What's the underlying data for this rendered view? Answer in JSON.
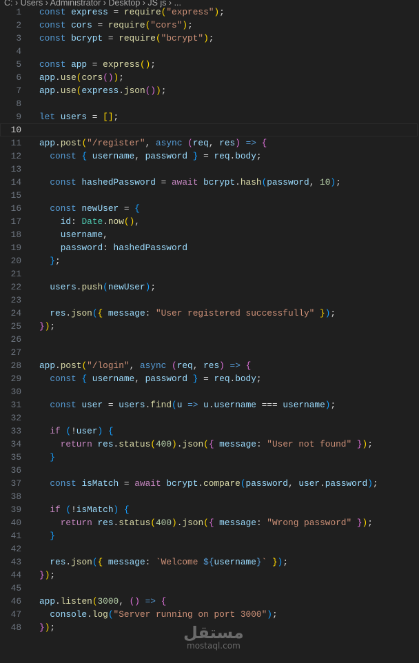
{
  "breadcrumb": "C: › Users › Administrator › Desktop › JS js › ...",
  "current_line": 10,
  "watermark": {
    "arabic": "مستقل",
    "latin": "mostaql.com"
  },
  "lines": [
    [
      [
        "k",
        "const "
      ],
      [
        "v",
        "express"
      ],
      [
        "p",
        " = "
      ],
      [
        "f",
        "require"
      ],
      [
        "b1",
        "("
      ],
      [
        "s",
        "\"express\""
      ],
      [
        "b1",
        ")"
      ],
      [
        "p",
        ";"
      ]
    ],
    [
      [
        "k",
        "const "
      ],
      [
        "v",
        "cors"
      ],
      [
        "p",
        " = "
      ],
      [
        "f",
        "require"
      ],
      [
        "b1",
        "("
      ],
      [
        "s",
        "\"cors\""
      ],
      [
        "b1",
        ")"
      ],
      [
        "p",
        ";"
      ]
    ],
    [
      [
        "k",
        "const "
      ],
      [
        "v",
        "bcrypt"
      ],
      [
        "p",
        " = "
      ],
      [
        "f",
        "require"
      ],
      [
        "b1",
        "("
      ],
      [
        "s",
        "\"bcrypt\""
      ],
      [
        "b1",
        ")"
      ],
      [
        "p",
        ";"
      ]
    ],
    [],
    [
      [
        "k",
        "const "
      ],
      [
        "v",
        "app"
      ],
      [
        "p",
        " = "
      ],
      [
        "f",
        "express"
      ],
      [
        "b1",
        "()"
      ],
      [
        "p",
        ";"
      ]
    ],
    [
      [
        "v",
        "app"
      ],
      [
        "p",
        "."
      ],
      [
        "f",
        "use"
      ],
      [
        "b1",
        "("
      ],
      [
        "f",
        "cors"
      ],
      [
        "b2",
        "()"
      ],
      [
        "b1",
        ")"
      ],
      [
        "p",
        ";"
      ]
    ],
    [
      [
        "v",
        "app"
      ],
      [
        "p",
        "."
      ],
      [
        "f",
        "use"
      ],
      [
        "b1",
        "("
      ],
      [
        "v",
        "express"
      ],
      [
        "p",
        "."
      ],
      [
        "f",
        "json"
      ],
      [
        "b2",
        "()"
      ],
      [
        "b1",
        ")"
      ],
      [
        "p",
        ";"
      ]
    ],
    [],
    [
      [
        "k",
        "let "
      ],
      [
        "v",
        "users"
      ],
      [
        "p",
        " = "
      ],
      [
        "b1",
        "[]"
      ],
      [
        "p",
        ";"
      ]
    ],
    [],
    [
      [
        "v",
        "app"
      ],
      [
        "p",
        "."
      ],
      [
        "f",
        "post"
      ],
      [
        "b1",
        "("
      ],
      [
        "s",
        "\"/register\""
      ],
      [
        "p",
        ", "
      ],
      [
        "k",
        "async "
      ],
      [
        "b2",
        "("
      ],
      [
        "v",
        "req"
      ],
      [
        "p",
        ", "
      ],
      [
        "v",
        "res"
      ],
      [
        "b2",
        ")"
      ],
      [
        "k",
        " =>"
      ],
      [
        "p",
        " "
      ],
      [
        "b2",
        "{"
      ]
    ],
    [
      [
        "p",
        "  "
      ],
      [
        "k",
        "const "
      ],
      [
        "b3",
        "{"
      ],
      [
        "v",
        " username"
      ],
      [
        "p",
        ", "
      ],
      [
        "v",
        "password "
      ],
      [
        "b3",
        "}"
      ],
      [
        "p",
        " = "
      ],
      [
        "v",
        "req"
      ],
      [
        "p",
        "."
      ],
      [
        "v",
        "body"
      ],
      [
        "p",
        ";"
      ]
    ],
    [],
    [
      [
        "p",
        "  "
      ],
      [
        "k",
        "const "
      ],
      [
        "v",
        "hashedPassword"
      ],
      [
        "p",
        " = "
      ],
      [
        "c",
        "await "
      ],
      [
        "v",
        "bcrypt"
      ],
      [
        "p",
        "."
      ],
      [
        "f",
        "hash"
      ],
      [
        "b3",
        "("
      ],
      [
        "v",
        "password"
      ],
      [
        "p",
        ", "
      ],
      [
        "n",
        "10"
      ],
      [
        "b3",
        ")"
      ],
      [
        "p",
        ";"
      ]
    ],
    [],
    [
      [
        "p",
        "  "
      ],
      [
        "k",
        "const "
      ],
      [
        "v",
        "newUser"
      ],
      [
        "p",
        " = "
      ],
      [
        "b3",
        "{"
      ]
    ],
    [
      [
        "p",
        "    "
      ],
      [
        "v",
        "id"
      ],
      [
        "p",
        ": "
      ],
      [
        "t",
        "Date"
      ],
      [
        "p",
        "."
      ],
      [
        "f",
        "now"
      ],
      [
        "b1",
        "()"
      ],
      [
        "p",
        ","
      ]
    ],
    [
      [
        "p",
        "    "
      ],
      [
        "v",
        "username"
      ],
      [
        "p",
        ","
      ]
    ],
    [
      [
        "p",
        "    "
      ],
      [
        "v",
        "password"
      ],
      [
        "p",
        ": "
      ],
      [
        "v",
        "hashedPassword"
      ]
    ],
    [
      [
        "p",
        "  "
      ],
      [
        "b3",
        "}"
      ],
      [
        "p",
        ";"
      ]
    ],
    [],
    [
      [
        "p",
        "  "
      ],
      [
        "v",
        "users"
      ],
      [
        "p",
        "."
      ],
      [
        "f",
        "push"
      ],
      [
        "b3",
        "("
      ],
      [
        "v",
        "newUser"
      ],
      [
        "b3",
        ")"
      ],
      [
        "p",
        ";"
      ]
    ],
    [],
    [
      [
        "p",
        "  "
      ],
      [
        "v",
        "res"
      ],
      [
        "p",
        "."
      ],
      [
        "f",
        "json"
      ],
      [
        "b3",
        "("
      ],
      [
        "b1",
        "{"
      ],
      [
        "v",
        " message"
      ],
      [
        "p",
        ": "
      ],
      [
        "s",
        "\"User registered successfully\""
      ],
      [
        "b1",
        " }"
      ],
      [
        "b3",
        ")"
      ],
      [
        "p",
        ";"
      ]
    ],
    [
      [
        "b2",
        "}"
      ],
      [
        "b1",
        ")"
      ],
      [
        "p",
        ";"
      ]
    ],
    [],
    [],
    [
      [
        "v",
        "app"
      ],
      [
        "p",
        "."
      ],
      [
        "f",
        "post"
      ],
      [
        "b1",
        "("
      ],
      [
        "s",
        "\"/login\""
      ],
      [
        "p",
        ", "
      ],
      [
        "k",
        "async "
      ],
      [
        "b2",
        "("
      ],
      [
        "v",
        "req"
      ],
      [
        "p",
        ", "
      ],
      [
        "v",
        "res"
      ],
      [
        "b2",
        ")"
      ],
      [
        "k",
        " =>"
      ],
      [
        "p",
        " "
      ],
      [
        "b2",
        "{"
      ]
    ],
    [
      [
        "p",
        "  "
      ],
      [
        "k",
        "const "
      ],
      [
        "b3",
        "{"
      ],
      [
        "v",
        " username"
      ],
      [
        "p",
        ", "
      ],
      [
        "v",
        "password "
      ],
      [
        "b3",
        "}"
      ],
      [
        "p",
        " = "
      ],
      [
        "v",
        "req"
      ],
      [
        "p",
        "."
      ],
      [
        "v",
        "body"
      ],
      [
        "p",
        ";"
      ]
    ],
    [],
    [
      [
        "p",
        "  "
      ],
      [
        "k",
        "const "
      ],
      [
        "v",
        "user"
      ],
      [
        "p",
        " = "
      ],
      [
        "v",
        "users"
      ],
      [
        "p",
        "."
      ],
      [
        "f",
        "find"
      ],
      [
        "b3",
        "("
      ],
      [
        "v",
        "u"
      ],
      [
        "k",
        " =>"
      ],
      [
        "p",
        " "
      ],
      [
        "v",
        "u"
      ],
      [
        "p",
        "."
      ],
      [
        "v",
        "username"
      ],
      [
        "p",
        " === "
      ],
      [
        "v",
        "username"
      ],
      [
        "b3",
        ")"
      ],
      [
        "p",
        ";"
      ]
    ],
    [],
    [
      [
        "p",
        "  "
      ],
      [
        "c",
        "if "
      ],
      [
        "b3",
        "("
      ],
      [
        "p",
        "!"
      ],
      [
        "v",
        "user"
      ],
      [
        "b3",
        ")"
      ],
      [
        "p",
        " "
      ],
      [
        "b3",
        "{"
      ]
    ],
    [
      [
        "p",
        "    "
      ],
      [
        "c",
        "return "
      ],
      [
        "v",
        "res"
      ],
      [
        "p",
        "."
      ],
      [
        "f",
        "status"
      ],
      [
        "b1",
        "("
      ],
      [
        "n",
        "400"
      ],
      [
        "b1",
        ")"
      ],
      [
        "p",
        "."
      ],
      [
        "f",
        "json"
      ],
      [
        "b1",
        "("
      ],
      [
        "b2",
        "{"
      ],
      [
        "v",
        " message"
      ],
      [
        "p",
        ": "
      ],
      [
        "s",
        "\"User not found\""
      ],
      [
        "b2",
        " }"
      ],
      [
        "b1",
        ")"
      ],
      [
        "p",
        ";"
      ]
    ],
    [
      [
        "p",
        "  "
      ],
      [
        "b3",
        "}"
      ]
    ],
    [],
    [
      [
        "p",
        "  "
      ],
      [
        "k",
        "const "
      ],
      [
        "v",
        "isMatch"
      ],
      [
        "p",
        " = "
      ],
      [
        "c",
        "await "
      ],
      [
        "v",
        "bcrypt"
      ],
      [
        "p",
        "."
      ],
      [
        "f",
        "compare"
      ],
      [
        "b3",
        "("
      ],
      [
        "v",
        "password"
      ],
      [
        "p",
        ", "
      ],
      [
        "v",
        "user"
      ],
      [
        "p",
        "."
      ],
      [
        "v",
        "password"
      ],
      [
        "b3",
        ")"
      ],
      [
        "p",
        ";"
      ]
    ],
    [],
    [
      [
        "p",
        "  "
      ],
      [
        "c",
        "if "
      ],
      [
        "b3",
        "("
      ],
      [
        "p",
        "!"
      ],
      [
        "v",
        "isMatch"
      ],
      [
        "b3",
        ")"
      ],
      [
        "p",
        " "
      ],
      [
        "b3",
        "{"
      ]
    ],
    [
      [
        "p",
        "    "
      ],
      [
        "c",
        "return "
      ],
      [
        "v",
        "res"
      ],
      [
        "p",
        "."
      ],
      [
        "f",
        "status"
      ],
      [
        "b1",
        "("
      ],
      [
        "n",
        "400"
      ],
      [
        "b1",
        ")"
      ],
      [
        "p",
        "."
      ],
      [
        "f",
        "json"
      ],
      [
        "b1",
        "("
      ],
      [
        "b2",
        "{"
      ],
      [
        "v",
        " message"
      ],
      [
        "p",
        ": "
      ],
      [
        "s",
        "\"Wrong password\""
      ],
      [
        "b2",
        " }"
      ],
      [
        "b1",
        ")"
      ],
      [
        "p",
        ";"
      ]
    ],
    [
      [
        "p",
        "  "
      ],
      [
        "b3",
        "}"
      ]
    ],
    [],
    [
      [
        "p",
        "  "
      ],
      [
        "v",
        "res"
      ],
      [
        "p",
        "."
      ],
      [
        "f",
        "json"
      ],
      [
        "b3",
        "("
      ],
      [
        "b1",
        "{"
      ],
      [
        "v",
        " message"
      ],
      [
        "p",
        ": "
      ],
      [
        "s",
        "`Welcome "
      ],
      [
        "k",
        "${"
      ],
      [
        "v",
        "username"
      ],
      [
        "k",
        "}"
      ],
      [
        "s",
        "`"
      ],
      [
        "b1",
        " }"
      ],
      [
        "b3",
        ")"
      ],
      [
        "p",
        ";"
      ]
    ],
    [
      [
        "b2",
        "}"
      ],
      [
        "b1",
        ")"
      ],
      [
        "p",
        ";"
      ]
    ],
    [],
    [
      [
        "v",
        "app"
      ],
      [
        "p",
        "."
      ],
      [
        "f",
        "listen"
      ],
      [
        "b1",
        "("
      ],
      [
        "n",
        "3000"
      ],
      [
        "p",
        ", "
      ],
      [
        "b2",
        "()"
      ],
      [
        "k",
        " =>"
      ],
      [
        "p",
        " "
      ],
      [
        "b2",
        "{"
      ]
    ],
    [
      [
        "p",
        "  "
      ],
      [
        "v",
        "console"
      ],
      [
        "p",
        "."
      ],
      [
        "f",
        "log"
      ],
      [
        "b3",
        "("
      ],
      [
        "s",
        "\"Server running on port 3000\""
      ],
      [
        "b3",
        ")"
      ],
      [
        "p",
        ";"
      ]
    ],
    [
      [
        "b2",
        "}"
      ],
      [
        "b1",
        ")"
      ],
      [
        "p",
        ";"
      ]
    ]
  ]
}
